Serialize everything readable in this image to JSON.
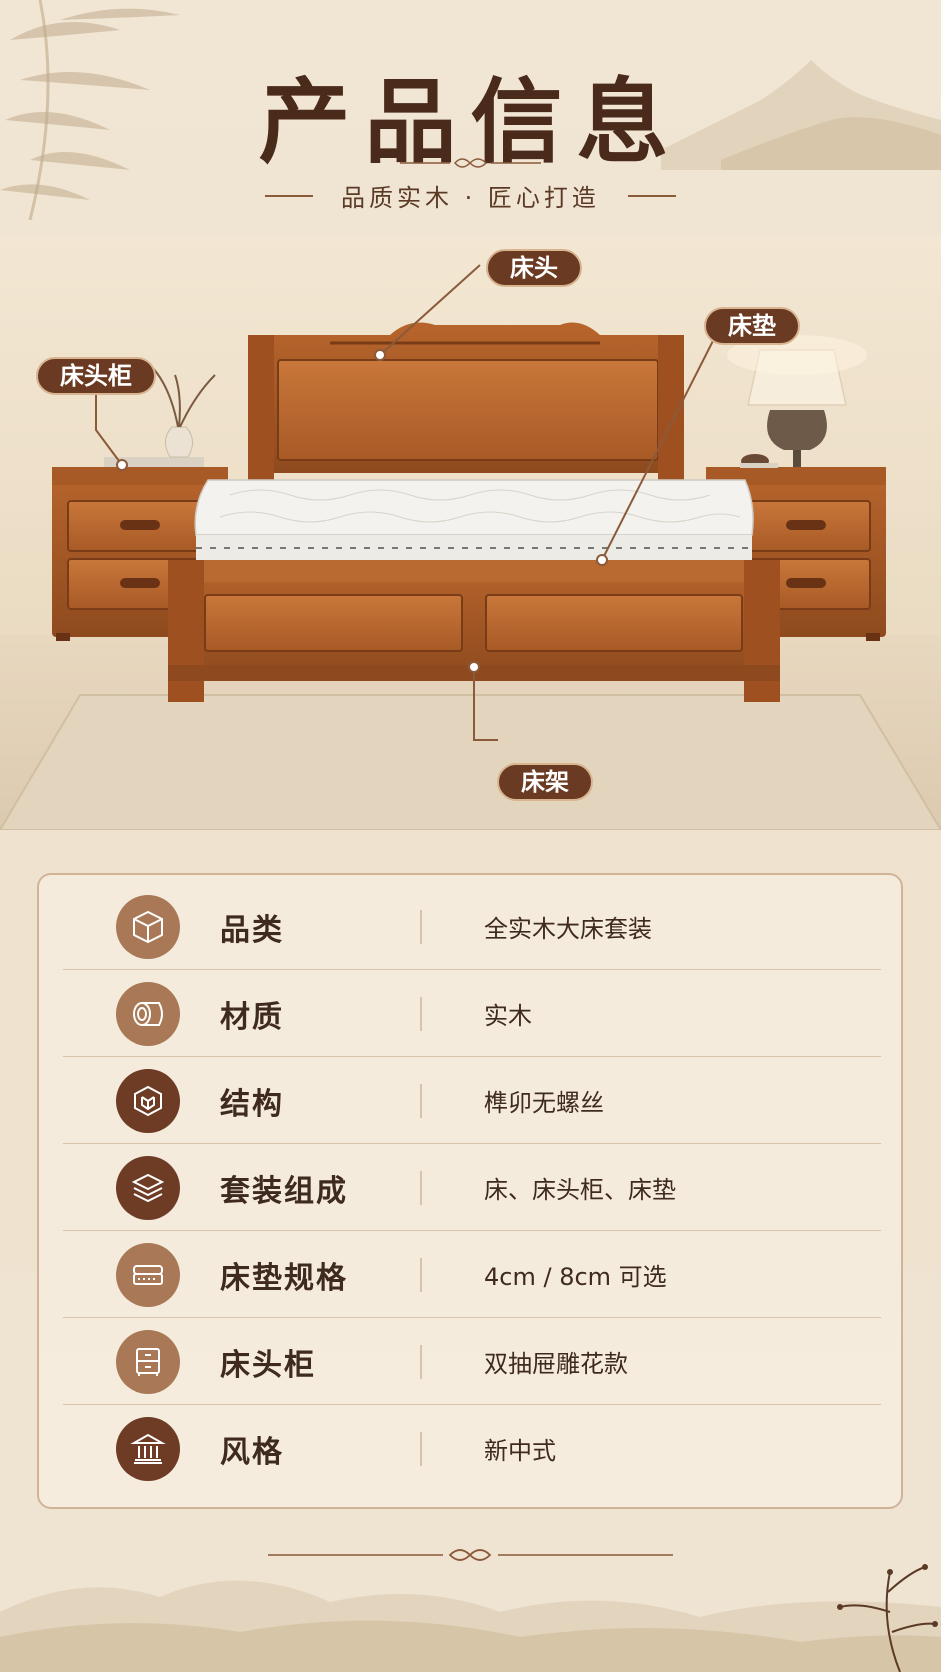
{
  "header": {
    "title": "产品信息",
    "subtitle": "品质实木 · 匠心打造"
  },
  "callouts": {
    "headboard": "床头",
    "mattress": "床垫",
    "nightstand": "床头柜",
    "frame": "床架"
  },
  "specs": [
    {
      "label": "品类",
      "value": "全实木大床套装",
      "icon": "box-icon"
    },
    {
      "label": "材质",
      "value": "实木",
      "icon": "wood-log-icon"
    },
    {
      "label": "结构",
      "value": "榫卯无螺丝",
      "icon": "joinery-icon"
    },
    {
      "label": "套装组成",
      "value": "床、床头柜、床垫",
      "icon": "layers-icon"
    },
    {
      "label": "床垫规格",
      "value": "4cm / 8cm 可选",
      "icon": "mattress-icon"
    },
    {
      "label": "床头柜",
      "value": "双抽屉雕花款",
      "icon": "nightstand-icon"
    },
    {
      "label": "风格",
      "value": "新中式",
      "icon": "pavilion-icon"
    }
  ],
  "colors": {
    "accent_dark": "#6a3a22",
    "icon_light": "#a97856",
    "icon_dark": "#6e3b24",
    "background": "#efe3cf"
  }
}
